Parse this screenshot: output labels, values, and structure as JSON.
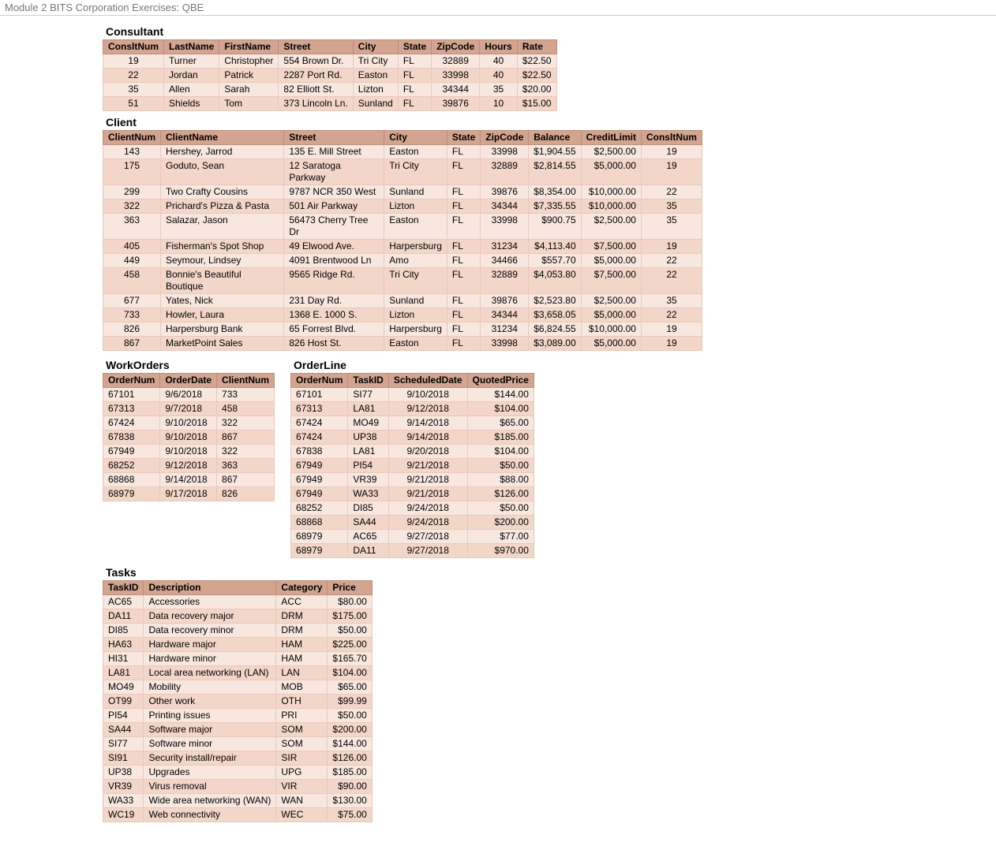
{
  "page_header": "Module 2 BITS Corporation Exercises: QBE",
  "consultant": {
    "title": "Consultant",
    "headers": [
      "ConsltNum",
      "LastName",
      "FirstName",
      "Street",
      "City",
      "State",
      "ZipCode",
      "Hours",
      "Rate"
    ],
    "rows": [
      [
        "19",
        "Turner",
        "Christopher",
        "554 Brown Dr.",
        "Tri City",
        "FL",
        "32889",
        "40",
        "$22.50"
      ],
      [
        "22",
        "Jordan",
        "Patrick",
        "2287 Port Rd.",
        "Easton",
        "FL",
        "33998",
        "40",
        "$22.50"
      ],
      [
        "35",
        "Allen",
        "Sarah",
        "82 Elliott St.",
        "Lizton",
        "FL",
        "34344",
        "35",
        "$20.00"
      ],
      [
        "51",
        "Shields",
        "Tom",
        "373 Lincoln Ln.",
        "Sunland",
        "FL",
        "39876",
        "10",
        "$15.00"
      ]
    ]
  },
  "client": {
    "title": "Client",
    "headers": [
      "ClientNum",
      "ClientName",
      "Street",
      "City",
      "State",
      "ZipCode",
      "Balance",
      "CreditLimit",
      "ConsltNum"
    ],
    "rows": [
      [
        "143",
        "Hershey, Jarrod",
        "135 E. Mill Street",
        "Easton",
        "FL",
        "33998",
        "$1,904.55",
        "$2,500.00",
        "19"
      ],
      [
        "175",
        "Goduto, Sean",
        "12 Saratoga Parkway",
        "Tri City",
        "FL",
        "32889",
        "$2,814.55",
        "$5,000.00",
        "19"
      ],
      [
        "299",
        "Two Crafty Cousins",
        "9787 NCR 350 West",
        "Sunland",
        "FL",
        "39876",
        "$8,354.00",
        "$10,000.00",
        "22"
      ],
      [
        "322",
        "Prichard's Pizza & Pasta",
        "501 Air Parkway",
        "Lizton",
        "FL",
        "34344",
        "$7,335.55",
        "$10,000.00",
        "35"
      ],
      [
        "363",
        "Salazar, Jason",
        "56473 Cherry Tree Dr",
        "Easton",
        "FL",
        "33998",
        "$900.75",
        "$2,500.00",
        "35"
      ],
      [
        "405",
        "Fisherman's Spot Shop",
        "49 Elwood Ave.",
        "Harpersburg",
        "FL",
        "31234",
        "$4,113.40",
        "$7,500.00",
        "19"
      ],
      [
        "449",
        "Seymour, Lindsey",
        "4091 Brentwood Ln",
        "Amo",
        "FL",
        "34466",
        "$557.70",
        "$5,000.00",
        "22"
      ],
      [
        "458",
        "Bonnie's Beautiful Boutique",
        "9565 Ridge Rd.",
        "Tri City",
        "FL",
        "32889",
        "$4,053.80",
        "$7,500.00",
        "22"
      ],
      [
        "677",
        "Yates, Nick",
        "231 Day Rd.",
        "Sunland",
        "FL",
        "39876",
        "$2,523.80",
        "$2,500.00",
        "35"
      ],
      [
        "733",
        "Howler, Laura",
        "1368 E. 1000 S.",
        "Lizton",
        "FL",
        "34344",
        "$3,658.05",
        "$5,000.00",
        "22"
      ],
      [
        "826",
        "Harpersburg Bank",
        "65 Forrest Blvd.",
        "Harpersburg",
        "FL",
        "31234",
        "$6,824.55",
        "$10,000.00",
        "19"
      ],
      [
        "867",
        "MarketPoint Sales",
        "826 Host St.",
        "Easton",
        "FL",
        "33998",
        "$3,089.00",
        "$5,000.00",
        "19"
      ]
    ]
  },
  "workorders": {
    "title": "WorkOrders",
    "headers": [
      "OrderNum",
      "OrderDate",
      "ClientNum"
    ],
    "rows": [
      [
        "67101",
        "9/6/2018",
        "733"
      ],
      [
        "67313",
        "9/7/2018",
        "458"
      ],
      [
        "67424",
        "9/10/2018",
        "322"
      ],
      [
        "67838",
        "9/10/2018",
        "867"
      ],
      [
        "67949",
        "9/10/2018",
        "322"
      ],
      [
        "68252",
        "9/12/2018",
        "363"
      ],
      [
        "68868",
        "9/14/2018",
        "867"
      ],
      [
        "68979",
        "9/17/2018",
        "826"
      ]
    ]
  },
  "orderline": {
    "title": "OrderLine",
    "headers": [
      "OrderNum",
      "TaskID",
      "ScheduledDate",
      "QuotedPrice"
    ],
    "rows": [
      [
        "67101",
        "SI77",
        "9/10/2018",
        "$144.00"
      ],
      [
        "67313",
        "LA81",
        "9/12/2018",
        "$104.00"
      ],
      [
        "67424",
        "MO49",
        "9/14/2018",
        "$65.00"
      ],
      [
        "67424",
        "UP38",
        "9/14/2018",
        "$185.00"
      ],
      [
        "67838",
        "LA81",
        "9/20/2018",
        "$104.00"
      ],
      [
        "67949",
        "PI54",
        "9/21/2018",
        "$50.00"
      ],
      [
        "67949",
        "VR39",
        "9/21/2018",
        "$88.00"
      ],
      [
        "67949",
        "WA33",
        "9/21/2018",
        "$126.00"
      ],
      [
        "68252",
        "DI85",
        "9/24/2018",
        "$50.00"
      ],
      [
        "68868",
        "SA44",
        "9/24/2018",
        "$200.00"
      ],
      [
        "68979",
        "AC65",
        "9/27/2018",
        "$77.00"
      ],
      [
        "68979",
        "DA11",
        "9/27/2018",
        "$970.00"
      ]
    ]
  },
  "tasks": {
    "title": "Tasks",
    "headers": [
      "TaskID",
      "Description",
      "Category",
      "Price"
    ],
    "rows": [
      [
        "AC65",
        "Accessories",
        "ACC",
        "$80.00"
      ],
      [
        "DA11",
        "Data recovery major",
        "DRM",
        "$175.00"
      ],
      [
        "DI85",
        "Data recovery minor",
        "DRM",
        "$50.00"
      ],
      [
        "HA63",
        "Hardware major",
        "HAM",
        "$225.00"
      ],
      [
        "HI31",
        "Hardware minor",
        "HAM",
        "$165.70"
      ],
      [
        "LA81",
        "Local area networking (LAN)",
        "LAN",
        "$104.00"
      ],
      [
        "MO49",
        "Mobility",
        "MOB",
        "$65.00"
      ],
      [
        "OT99",
        "Other work",
        "OTH",
        "$99.99"
      ],
      [
        "PI54",
        "Printing issues",
        "PRI",
        "$50.00"
      ],
      [
        "SA44",
        "Software major",
        "SOM",
        "$200.00"
      ],
      [
        "SI77",
        "Software minor",
        "SOM",
        "$144.00"
      ],
      [
        "SI91",
        "Security install/repair",
        "SIR",
        "$126.00"
      ],
      [
        "UP38",
        "Upgrades",
        "UPG",
        "$185.00"
      ],
      [
        "VR39",
        "Virus removal",
        "VIR",
        "$90.00"
      ],
      [
        "WA33",
        "Wide area networking (WAN)",
        "WAN",
        "$130.00"
      ],
      [
        "WC19",
        "Web connectivity",
        "WEC",
        "$75.00"
      ]
    ]
  }
}
